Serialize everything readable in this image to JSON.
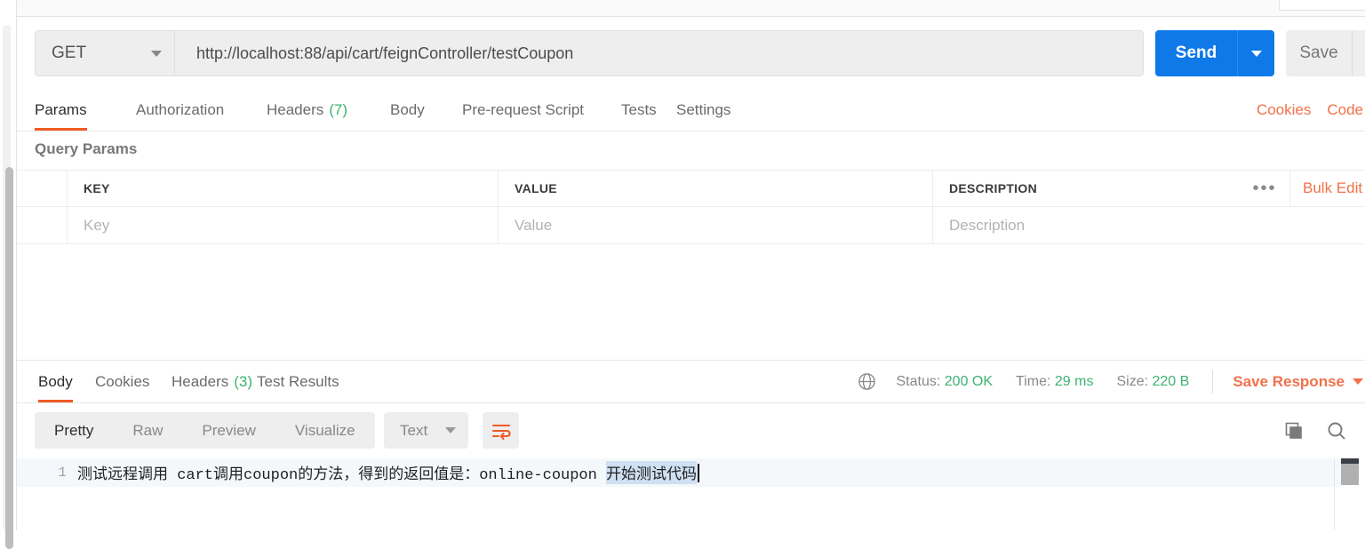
{
  "request": {
    "method": "GET",
    "url": "http://localhost:88/api/cart/feignController/testCoupon",
    "send_label": "Send",
    "save_label": "Save",
    "tabs": [
      {
        "label": "Params",
        "count": "",
        "active": true
      },
      {
        "label": "Authorization",
        "count": "",
        "active": false
      },
      {
        "label": "Headers",
        "count": "(7)",
        "active": false
      },
      {
        "label": "Body",
        "count": "",
        "active": false
      },
      {
        "label": "Pre-request Script",
        "count": "",
        "active": false
      },
      {
        "label": "Tests",
        "count": "",
        "active": false
      },
      {
        "label": "Settings",
        "count": "",
        "active": false
      }
    ],
    "links": [
      {
        "label": "Cookies"
      },
      {
        "label": "Code"
      }
    ]
  },
  "query_params": {
    "title": "Query Params",
    "columns": [
      "KEY",
      "VALUE",
      "DESCRIPTION"
    ],
    "placeholders": [
      "Key",
      "Value",
      "Description"
    ],
    "ellipsis": "•••",
    "bulk_edit": "Bulk Edit"
  },
  "response": {
    "tabs": [
      {
        "label": "Body",
        "count": "",
        "active": true
      },
      {
        "label": "Cookies",
        "count": "",
        "active": false
      },
      {
        "label": "Headers",
        "count": "(3)",
        "active": false
      },
      {
        "label": "Test Results",
        "count": "",
        "active": false
      }
    ],
    "status_label": "Status:",
    "status_value": "200 OK",
    "time_label": "Time:",
    "time_value": "29 ms",
    "size_label": "Size:",
    "size_value": "220 B",
    "save_response": "Save Response",
    "format_tabs": [
      {
        "label": "Pretty",
        "active": true
      },
      {
        "label": "Raw",
        "active": false
      },
      {
        "label": "Preview",
        "active": false
      },
      {
        "label": "Visualize",
        "active": false
      }
    ],
    "content_type": "Text",
    "line_number": "1",
    "body_text_plain": "测试远程调用 cart调用coupon的方法，得到的返回值是：online-coupon ",
    "body_text_selected": "开始测试代码"
  },
  "icons": {
    "method_caret": "chevron-down-icon",
    "send_caret": "chevron-down-icon",
    "save_caret": "chevron-down-icon",
    "globe": "globe-icon",
    "wrap": "word-wrap-icon",
    "copy": "copy-icon",
    "search": "search-icon",
    "ellipsis": "ellipsis-icon"
  },
  "colors": {
    "accent_orange": "#ef5b25",
    "link_orange": "#f0714a",
    "send_blue": "#1079e8",
    "status_green": "#3cb371",
    "selection_blue": "#cfe0f2"
  }
}
